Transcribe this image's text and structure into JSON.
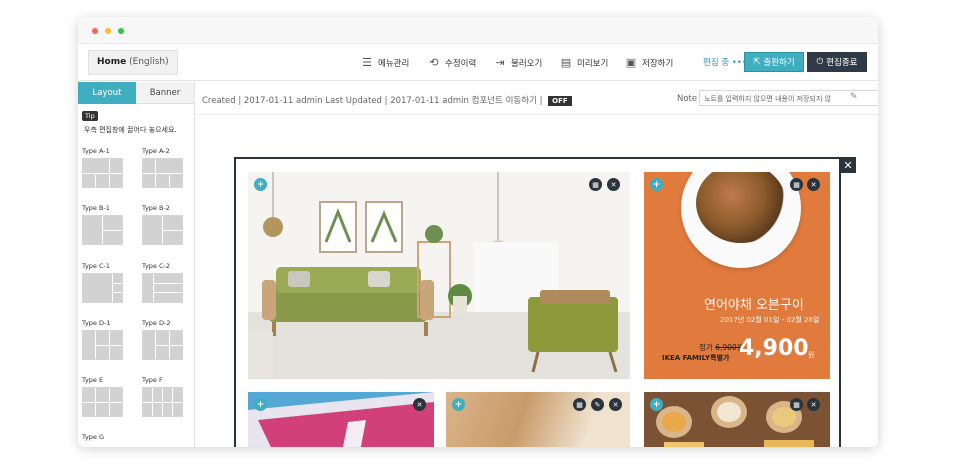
{
  "toolbar": {
    "home_label": "Home",
    "home_lang": "(English)",
    "menu_manage": "메뉴관리",
    "history": "수정이력",
    "import": "불러오기",
    "preview": "미리보기",
    "save": "저장하기",
    "edit_status": "편집 중 •••",
    "publish": "출판하기",
    "exit_edit": "편집종료"
  },
  "sidebar": {
    "tab_layout": "Layout",
    "tab_banner": "Banner",
    "tip_badge": "Tip",
    "tip_text": "우측 편집창에 끌어다 놓으세요.",
    "layouts": [
      "Type A-1",
      "Type A-2",
      "Type B-1",
      "Type B-2",
      "Type C-1",
      "Type C-2",
      "Type D-1",
      "Type D-2",
      "Type E",
      "Type F",
      "Type G"
    ]
  },
  "info": {
    "meta_text": "Created | 2017-01-11 admin   Last Updated | 2017-01-11 admin   컴포넌트 이동하기 |",
    "toggle": "OFF",
    "note_label": "Note",
    "note_placeholder": "노트를 입력하지 않으면 내용이 저장되지 않"
  },
  "promo": {
    "title": "연어야채 오븐구이",
    "date": "2017년 02월 01일 - 02월 28일",
    "regular_label": "정가",
    "regular_price": "6,900원",
    "family_label": "IKEA FAMILY특별가",
    "price": "4,900",
    "won": "원"
  },
  "colors": {
    "accent": "#3eaec0",
    "dark": "#2b333d",
    "promo_bg": "#e07a3d"
  }
}
